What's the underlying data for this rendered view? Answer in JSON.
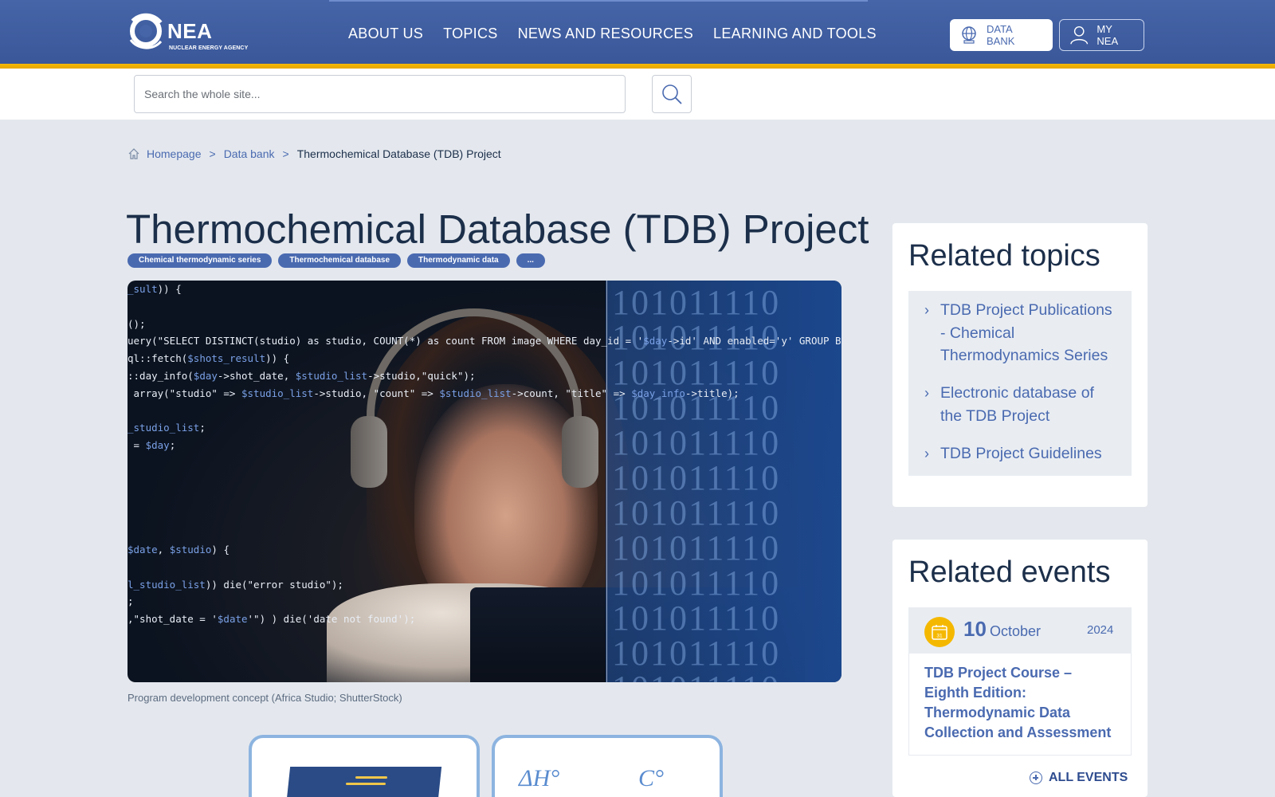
{
  "header": {
    "logo_text": "NEA",
    "logo_subtitle": "NUCLEAR ENERGY AGENCY",
    "nav": [
      "ABOUT US",
      "TOPICS",
      "NEWS AND RESOURCES",
      "LEARNING AND TOOLS"
    ],
    "data_bank_label": "DATA BANK",
    "my_nea_label": "MY NEA",
    "colors": {
      "primary": "#4565a8",
      "accent": "#f5b800",
      "link": "#4a6ab0"
    }
  },
  "search": {
    "placeholder": "Search the whole site...",
    "value": "",
    "icon": "search-icon"
  },
  "breadcrumb": {
    "home": "Homepage",
    "sep1": ">",
    "parent": "Data bank",
    "sep2": ">",
    "current": "Thermochemical Database (TDB) Project"
  },
  "page": {
    "title": "Thermochemical Database (TDB) Project",
    "tags": [
      "Chemical thermodynamic series",
      "Thermochemical database",
      "Thermodynamic data",
      "..."
    ],
    "image_caption": "Program development concept (Africa Studio; ShutterStock)"
  },
  "related_topics": {
    "title": "Related topics",
    "items": [
      "TDB Project Publications - Chemical Thermodynamics Series",
      "Electronic database of the TDB Project",
      "TDB Project Guidelines"
    ]
  },
  "related_events": {
    "title": "Related events",
    "calendar_icon_text": "31",
    "event": {
      "day": "10",
      "month": "October",
      "year": "2024",
      "title": "TDB Project Course – Eighth Edition: Thermodynamic Data Collection and Assessment"
    },
    "all_events_label": "ALL EVENTS"
  }
}
